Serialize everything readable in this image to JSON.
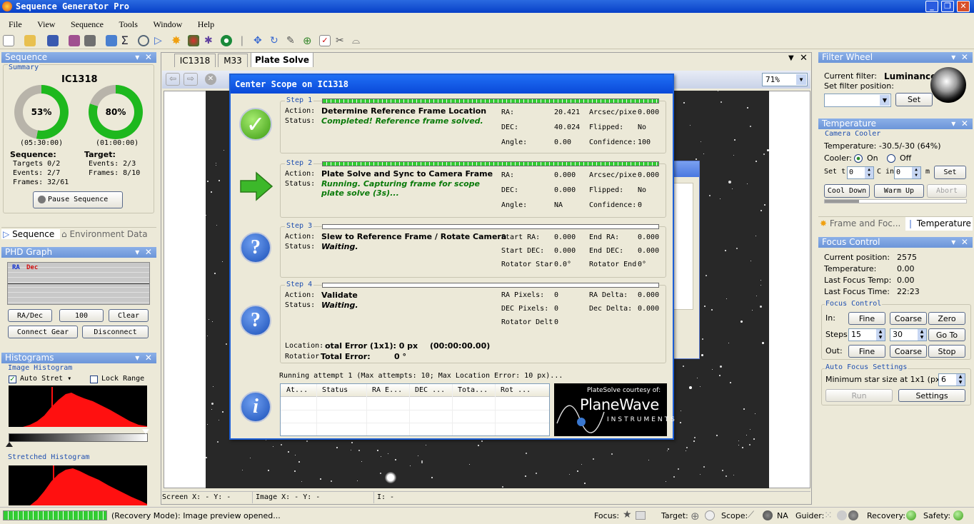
{
  "app": {
    "title": "Sequence Generator Pro"
  },
  "menu": [
    "File",
    "View",
    "Sequence",
    "Tools",
    "Window",
    "Help"
  ],
  "sequence_panel": {
    "title": "Sequence",
    "summary_label": "Summary",
    "target_name": "IC1318",
    "ring1_pct": "53%",
    "ring1_value": 0.53,
    "ring1_time": "(05:30:00)",
    "ring2_pct": "80%",
    "ring2_value": 0.8,
    "ring2_time": "(01:00:00)",
    "seq_head": "Sequence:",
    "seq_targets": "Targets 0/2",
    "seq_events": "Events: 2/7",
    "seq_frames": "Frames: 32/61",
    "tgt_head": "Target:",
    "tgt_events": "Events: 2/3",
    "tgt_frames": "Frames: 8/10",
    "pause_label": "Pause Sequence",
    "tab_sequence": "Sequence",
    "tab_env": "Environment Data"
  },
  "phd_panel": {
    "title": "PHD Graph",
    "ra": "RA",
    "dec": "Dec",
    "radec_btn": "RA/Dec",
    "scale_btn": "100",
    "clear_btn": "Clear",
    "connect_btn": "Connect Gear",
    "disconnect_btn": "Disconnect"
  },
  "histo_panel": {
    "title": "Histograms",
    "image_label": "Image Histogram",
    "auto_stretch": "Auto Stret",
    "lock_range": "Lock Range",
    "stretched_label": "Stretched Histogram"
  },
  "tabs": [
    "IC1318",
    "M33",
    "Plate Solve"
  ],
  "zoom": "71%",
  "viewer_status": {
    "screen": "Screen X: - Y: -",
    "image": "Image X: - Y: -",
    "intensity": "I: -"
  },
  "dialog": {
    "title": "Center Scope on IC1318",
    "action_lbl": "Action:",
    "status_lbl": "Status:",
    "steps": [
      {
        "label": "Step 1",
        "progress": 1.0,
        "action": "Determine Reference Frame Location",
        "status": "Completed!  Reference frame solved.",
        "fields": [
          [
            "RA:",
            "20.421",
            "Arcsec/pixe",
            "0.000"
          ],
          [
            "DEC:",
            "40.024",
            "Flipped:",
            "No"
          ],
          [
            "Angle:",
            "0.00",
            "Confidence:",
            "100"
          ]
        ]
      },
      {
        "label": "Step 2",
        "progress": 1.0,
        "action": "Plate Solve and Sync to Camera Frame",
        "status": "Running.  Capturing frame for scope plate solve (3s)...",
        "fields": [
          [
            "RA:",
            "0.000",
            "Arcsec/pixe",
            "0.000"
          ],
          [
            "DEC:",
            "0.000",
            "Flipped:",
            "No"
          ],
          [
            "Angle:",
            "NA",
            "Confidence:",
            "0"
          ]
        ]
      },
      {
        "label": "Step 3",
        "progress": 0.0,
        "action": "Slew to Reference Frame / Rotate Camera",
        "status": "Waiting.",
        "fields": [
          [
            "Start RA:",
            "0.000",
            "End RA:",
            "0.000"
          ],
          [
            "Start DEC:",
            "0.000",
            "End DEC:",
            "0.000"
          ],
          [
            "Rotator Star",
            "0.0°",
            "Rotator End",
            "0°"
          ]
        ]
      },
      {
        "label": "Step 4",
        "progress": 0.0,
        "action": "Validate",
        "status": "Waiting.",
        "fields": [
          [
            "RA Pixels:",
            "0",
            "RA Delta:",
            "0.000"
          ],
          [
            "DEC Pixels:",
            "0",
            "Dec Delta:",
            "0.000"
          ],
          [
            "Rotator Delt",
            "0",
            "",
            ""
          ]
        ]
      }
    ],
    "location_lbl": "Location:",
    "location_val": "otal Error (1x1):  0 px",
    "location_time": "(00:00:00.00)",
    "rotation_lbl": "Rotatior",
    "rotation_val": "Total Error:",
    "rotation_num": "0 °",
    "attempt_text": "Running attempt 1 (Max attempts: 10; Max Location Error: 10 px)...",
    "table_cols": [
      "At...",
      "Status",
      "RA E...",
      "DEC ...",
      "Tota...",
      "Rot ..."
    ],
    "logo_top": "PlateSolve courtesy of:",
    "logo_main": "PlaneWave",
    "logo_sub": "INSTRUMENTS"
  },
  "filter_wheel": {
    "title": "Filter Wheel",
    "current_lbl": "Current filter:",
    "current_val": "Luminance",
    "set_lbl": "Set filter position:",
    "set_btn": "Set"
  },
  "temperature": {
    "title": "Temperature",
    "group": "Camera Cooler",
    "temp_text": "Temperature: -30.5/-30 (64%)",
    "cooler_lbl": "Cooler:",
    "on": "On",
    "off": "Off",
    "set_lbl": "Set t",
    "set_val1": "0",
    "c_in": "C in",
    "set_val2": "0",
    "m": "m",
    "set_btn": "Set",
    "cool_down": "Cool Down",
    "warm_up": "Warm Up",
    "abort": "Abort",
    "tab_frame": "Frame and Foc...",
    "tab_temp": "Temperature"
  },
  "focus": {
    "title": "Focus Control",
    "rows": [
      [
        "Current position:",
        "2575"
      ],
      [
        "Temperature:",
        "0.00"
      ],
      [
        "Last Focus Temp:",
        "0.00"
      ],
      [
        "Last Focus Time:",
        "22:23"
      ]
    ],
    "group": "Focus Control",
    "in_lbl": "In:",
    "fine": "Fine",
    "coarse": "Coarse",
    "zero": "Zero",
    "steps_lbl": "Steps:",
    "steps_fine": "15",
    "steps_coarse": "30",
    "goto": "Go To",
    "out_lbl": "Out:",
    "stop": "Stop",
    "af_group": "Auto Focus Settings",
    "min_star_lbl": "Minimum star size at 1x1 (px):",
    "min_star_val": "6",
    "run": "Run",
    "settings": "Settings"
  },
  "statusbar": {
    "message": "(Recovery Mode): Image preview opened...",
    "focus": "Focus:",
    "target": "Target:",
    "scope": "Scope:",
    "scope_val": "NA",
    "guider": "Guider:",
    "recovery": "Recovery:",
    "safety": "Safety:"
  }
}
